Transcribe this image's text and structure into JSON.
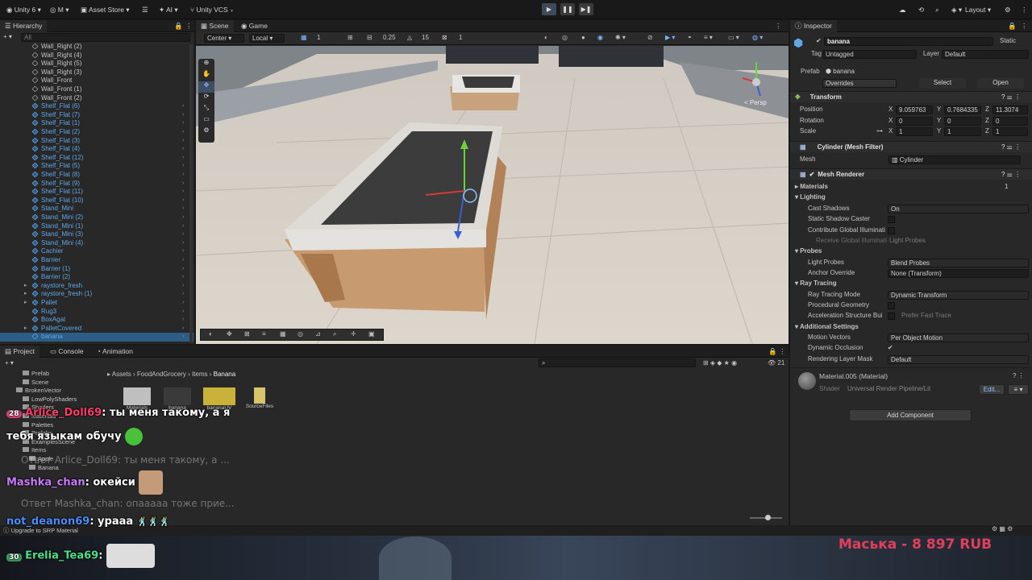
{
  "topbar": {
    "account": "Unity 6",
    "m_menu": "M",
    "asset_store": "Asset Store",
    "ai": "AI",
    "vcs": "Unity VCS",
    "layout": "Layout"
  },
  "hierarchy": {
    "tab": "Hierarchy",
    "search_placeholder": "All",
    "items": [
      {
        "label": "Wall_Right (2)",
        "blue": false
      },
      {
        "label": "Wall_Right (4)",
        "blue": false
      },
      {
        "label": "Wall_Right (5)",
        "blue": false
      },
      {
        "label": "Wall_Right (3)",
        "blue": false
      },
      {
        "label": "Wall_Front",
        "blue": false
      },
      {
        "label": "Wall_Front (1)",
        "blue": false
      },
      {
        "label": "Wall_Front (2)",
        "blue": false
      },
      {
        "label": "Shelf_Flat (6)",
        "blue": true
      },
      {
        "label": "Shelf_Flat (7)",
        "blue": true
      },
      {
        "label": "Shelf_Flat (1)",
        "blue": true
      },
      {
        "label": "Shelf_Flat (2)",
        "blue": true
      },
      {
        "label": "Shelf_Flat (3)",
        "blue": true
      },
      {
        "label": "Shelf_Flat (4)",
        "blue": true
      },
      {
        "label": "Shelf_Flat (12)",
        "blue": true
      },
      {
        "label": "Shelf_Flat (5)",
        "blue": true
      },
      {
        "label": "Shelf_Flat (8)",
        "blue": true
      },
      {
        "label": "Shelf_Flat (9)",
        "blue": true
      },
      {
        "label": "Shelf_Flat (11)",
        "blue": true
      },
      {
        "label": "Shelf_Flat (10)",
        "blue": true
      },
      {
        "label": "Stand_Mini",
        "blue": true
      },
      {
        "label": "Stand_Mini (2)",
        "blue": true
      },
      {
        "label": "Stand_Mini (1)",
        "blue": true
      },
      {
        "label": "Stand_Mini (3)",
        "blue": true
      },
      {
        "label": "Stand_Mini (4)",
        "blue": true
      },
      {
        "label": "Cachier",
        "blue": true
      },
      {
        "label": "Barrier",
        "blue": true
      },
      {
        "label": "Barrier (1)",
        "blue": true
      },
      {
        "label": "Barrier (2)",
        "blue": true
      },
      {
        "label": "raystore_fresh",
        "blue": true
      },
      {
        "label": "raystore_fresh (1)",
        "blue": true
      },
      {
        "label": "Pallet",
        "blue": true
      },
      {
        "label": "Rug3",
        "blue": true
      },
      {
        "label": "BoxAgat",
        "blue": true
      },
      {
        "label": "PalletCovered",
        "blue": true
      },
      {
        "label": "banana",
        "blue": true
      }
    ]
  },
  "scene": {
    "tab_scene": "Scene",
    "tab_game": "Game",
    "pivot": "Center",
    "space": "Local",
    "grid_value": "1",
    "snap_value": "0.25",
    "angle_value": "15",
    "scale_value": "1",
    "gizmo_label": "< Persp"
  },
  "inspector": {
    "tab": "Inspector",
    "object_name": "banana",
    "static_label": "Static",
    "tag_label": "Tag",
    "tag_value": "Untagged",
    "layer_label": "Layer",
    "layer_value": "Default",
    "prefab_label": "Prefab",
    "prefab_value": "banana",
    "overrides": "Overrides",
    "select_btn": "Select",
    "open_btn": "Open",
    "transform": {
      "title": "Transform",
      "position_label": "Position",
      "rotation_label": "Rotation",
      "scale_label": "Scale",
      "pos_x": "9.059763",
      "pos_y": "0.7684335",
      "pos_z": "11.3074",
      "rot_x": "0",
      "rot_y": "0",
      "rot_z": "0",
      "scl_x": "1",
      "scl_y": "1",
      "scl_z": "1"
    },
    "mesh_filter": {
      "title": "Cylinder (Mesh Filter)",
      "mesh_label": "Mesh",
      "mesh_value": "Cylinder"
    },
    "mesh_renderer": {
      "title": "Mesh Renderer",
      "materials_label": "Materials",
      "materials_count": "1",
      "lighting": "Lighting",
      "cast_shadows_label": "Cast Shadows",
      "cast_shadows_value": "On",
      "static_shadow": "Static Shadow Caster",
      "contribute_gi": "Contribute Global Illuminati",
      "receive_gi": "Receive Global Illuminati",
      "receive_gi_value": "Light Probes",
      "probes": "Probes",
      "light_probes_label": "Light Probes",
      "light_probes_value": "Blend Probes",
      "anchor_label": "Anchor Override",
      "anchor_value": "None (Transform)",
      "ray_tracing": "Ray Tracing",
      "rt_mode_label": "Ray Tracing Mode",
      "rt_mode_value": "Dynamic Transform",
      "procedural": "Procedural Geometry",
      "accel_label": "Acceleration Structure Bui",
      "accel_value": "Prefer Fast Trace",
      "additional": "Additional Settings",
      "motion_label": "Motion Vectors",
      "motion_value": "Per Object Motion",
      "dyn_occ": "Dynamic Occlusion",
      "rlm_label": "Rendering Layer Mask",
      "rlm_value": "Default"
    },
    "material": {
      "title": "Material.005 (Material)",
      "shader_label": "Shader",
      "shader_value": "Universal Render Pipeline/Lit",
      "edit": "Edit..."
    },
    "add_component": "Add Component"
  },
  "project": {
    "tab_project": "Project",
    "tab_console": "Console",
    "tab_animation": "Animation",
    "breadcrumb": [
      "Assets",
      "FoodAndGrocery",
      "Items",
      "Banana"
    ],
    "tree": [
      "Prefab",
      "Scene",
      "BrokenVector",
      "LowPolyShaders",
      "Shaders",
      "Materials",
      "Palettes",
      "Prefabs",
      "ExamplesScene",
      "Items",
      "Apple",
      "Banana"
    ],
    "assets": [
      "Materials",
      "banana",
      "bananaUV",
      "SourceFiles"
    ],
    "count": "21",
    "status": "Upgrade to SRP Material"
  },
  "chat": [
    {
      "badge": "28",
      "user": "Arlice_Doll69",
      "text": ": ты меня такому, а я"
    },
    {
      "text2": "тебя языкам обучу"
    },
    {
      "reply": "Ответ Arlice_Doll69: ты меня такому, а ..."
    },
    {
      "user": "Mashka_chan",
      "text": ": окейси"
    },
    {
      "reply": "Ответ Mashka_chan: опааааа тоже прие..."
    },
    {
      "user": "not_deanon69",
      "text": ": урааа"
    },
    {
      "badge": "30",
      "user": "Erelia_Tea69",
      "text": ":"
    }
  ],
  "donation": "Маська - 8 897 RUB",
  "colors": {
    "accent": "#5fa7e6",
    "donation": "#e0405a",
    "user1": "#ff3b6a",
    "user2": "#c97aff",
    "user3": "#4a8cff",
    "user4": "#48e08a"
  }
}
